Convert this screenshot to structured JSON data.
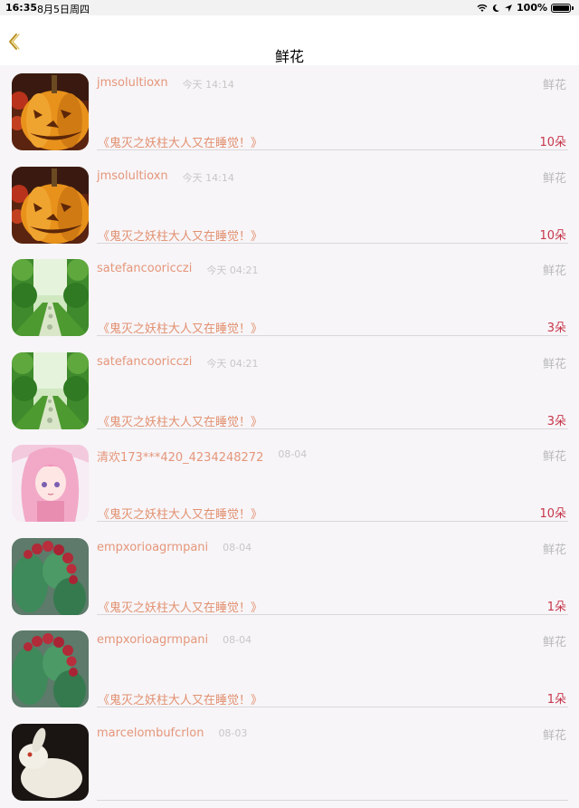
{
  "status_bar": {
    "time": "16:35",
    "date": "8月5日周四",
    "battery": "100%",
    "icons": [
      "wifi-icon",
      "moon-icon",
      "location-arrow-icon",
      "battery-icon"
    ]
  },
  "nav": {
    "title": "鲜花",
    "back_icon": "chevron-left-icon",
    "accent_color": "#c9a227"
  },
  "colors": {
    "username": "#e5967a",
    "book_title": "#e2906f",
    "count": "#c6364a",
    "meta": "#c9c6c6",
    "background": "#f7f5f8"
  },
  "items": [
    {
      "avatar": "pumpkin-image",
      "username": "jmsolultioxn",
      "time": "今天 14:14",
      "category": "鲜花",
      "title": "《鬼灭之妖柱大人又在睡觉！》",
      "count": "10朵"
    },
    {
      "avatar": "pumpkin-image",
      "username": "jmsolultioxn",
      "time": "今天 14:14",
      "category": "鲜花",
      "title": "《鬼灭之妖柱大人又在睡觉！》",
      "count": "10朵"
    },
    {
      "avatar": "garden-path-image",
      "username": "satefancooricczi",
      "time": "今天 04:21",
      "category": "鲜花",
      "title": "《鬼灭之妖柱大人又在睡觉！》",
      "count": "3朵"
    },
    {
      "avatar": "garden-path-image",
      "username": "satefancooricczi",
      "time": "今天 04:21",
      "category": "鲜花",
      "title": "《鬼灭之妖柱大人又在睡觉！》",
      "count": "3朵"
    },
    {
      "avatar": "anime-girl-image",
      "username": "清欢173***420_4234248272",
      "time": "08-04",
      "category": "鲜花",
      "title": "《鬼灭之妖柱大人又在睡觉！》",
      "count": "10朵"
    },
    {
      "avatar": "cactus-image",
      "username": "empxorioagrmpani",
      "time": "08-04",
      "category": "鲜花",
      "title": "《鬼灭之妖柱大人又在睡觉！》",
      "count": "1朵"
    },
    {
      "avatar": "cactus-image",
      "username": "empxorioagrmpani",
      "time": "08-04",
      "category": "鲜花",
      "title": "《鬼灭之妖柱大人又在睡觉！》",
      "count": "1朵"
    },
    {
      "avatar": "jade-rabbit-image",
      "username": "marcelombufcrlon",
      "time": "08-03",
      "category": "鲜花",
      "title": "",
      "count": ""
    }
  ]
}
